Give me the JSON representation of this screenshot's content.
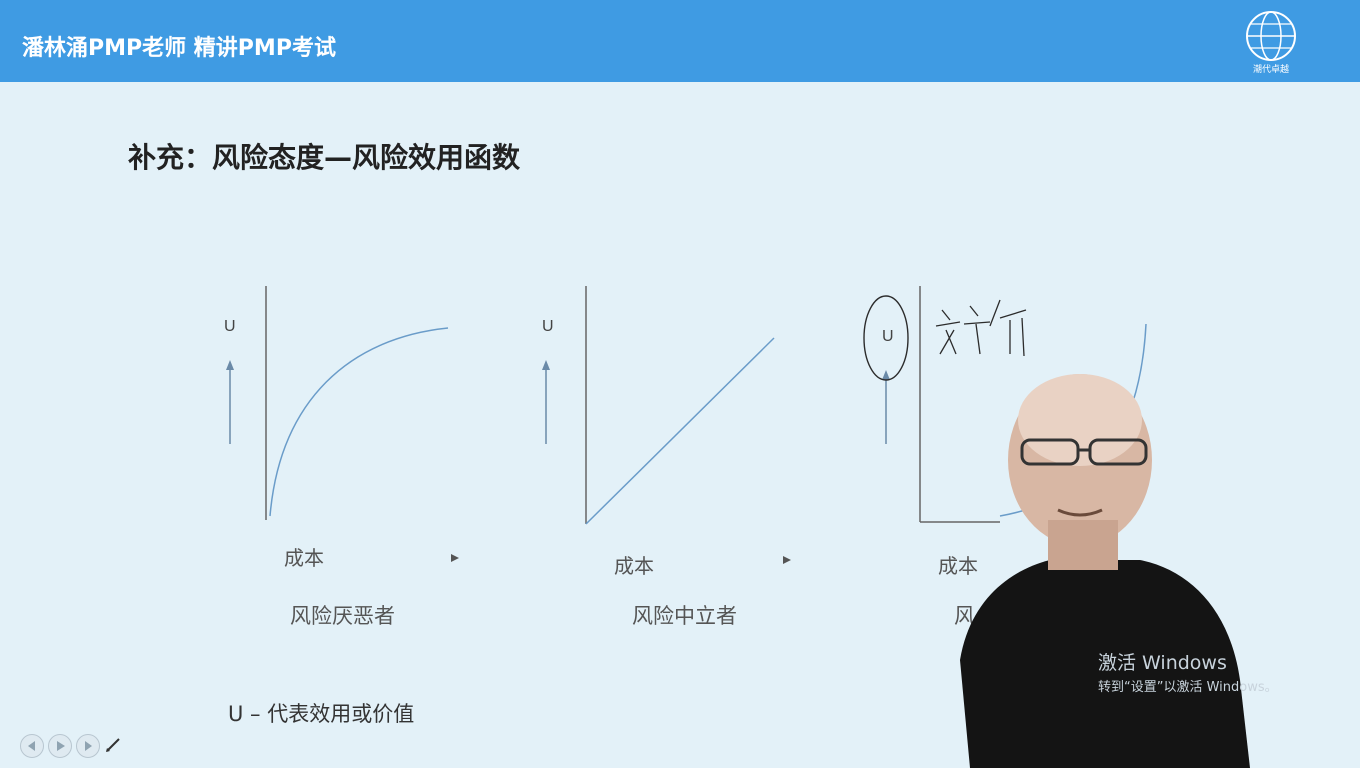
{
  "header": {
    "title": "潘林涌PMP老师 精讲PMP考试"
  },
  "slide": {
    "title": "补充：风险态度—风险效用函数",
    "panels": [
      {
        "u_label": "U",
        "cost_label": "成本",
        "type_label": "风险厌恶者"
      },
      {
        "u_label": "U",
        "cost_label": "成本",
        "type_label": "风险中立者"
      },
      {
        "u_label": "U",
        "cost_label": "成本",
        "type_label": "风"
      }
    ],
    "legend": "U – 代表效用或价值",
    "logo_text": "潮代卓越"
  },
  "overlay": {
    "watermark_line1": "激活 Windows",
    "watermark_line2": "转到“设置”以激活 Windows。"
  },
  "colors": {
    "topbar": "#3f9be3",
    "background": "#e3f1f8",
    "curve": "#6a9cc9"
  },
  "icons": [
    "globe-logo-icon",
    "previous-icon",
    "play-icon",
    "next-icon",
    "pen-icon"
  ]
}
